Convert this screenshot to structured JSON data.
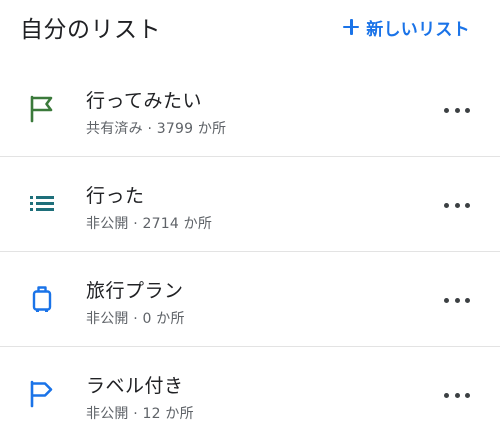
{
  "header": {
    "title": "自分のリスト",
    "new_list_label": "新しいリスト"
  },
  "lists": [
    {
      "icon": "flag-icon",
      "icon_color": "#3b7a3b",
      "title": "行ってみたい",
      "subtitle": "共有済み · 3799 か所"
    },
    {
      "icon": "list-icon",
      "icon_color": "#1e6f7a",
      "title": "行った",
      "subtitle": "非公開 · 2714 か所"
    },
    {
      "icon": "suitcase-icon",
      "icon_color": "#1a73e8",
      "title": "旅行プラン",
      "subtitle": "非公開 · 0 か所"
    },
    {
      "icon": "label-flag-icon",
      "icon_color": "#1a73e8",
      "title": "ラベル付き",
      "subtitle": "非公開 · 12 か所"
    }
  ],
  "colors": {
    "accent": "#1a73e8",
    "text_primary": "#202124",
    "text_secondary": "#5f6368",
    "divider": "#e3e3e3"
  }
}
